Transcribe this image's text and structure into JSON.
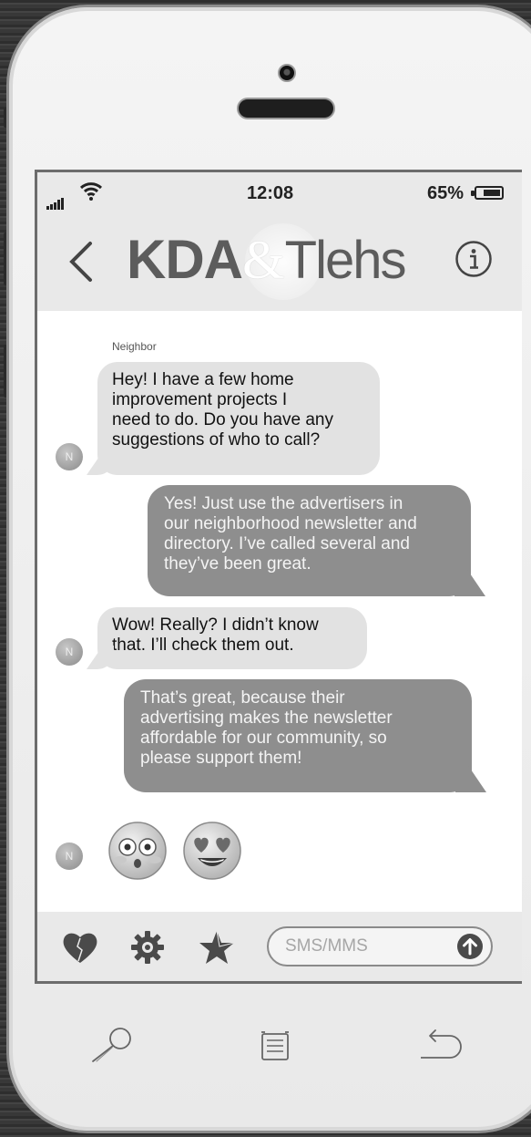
{
  "status_bar": {
    "time": "12:08",
    "battery_percent": "65%"
  },
  "header": {
    "logo_part1": "KDA",
    "logo_amp": "&",
    "logo_part2": "Tlehs"
  },
  "conversation": {
    "sender_label": "Neighbor",
    "avatar_initial": "N",
    "messages": [
      {
        "direction": "incoming",
        "lines": [
          "Hey! I have a few home",
          "improvement projects I",
          "need to do. Do you have any",
          "suggestions of who to call?"
        ]
      },
      {
        "direction": "outgoing",
        "lines": [
          "Yes! Just use the advertisers in",
          "our neighborhood newsletter and",
          "directory. I’ve called several and",
          "they’ve been great."
        ]
      },
      {
        "direction": "incoming",
        "lines": [
          "Wow! Really? I didn’t know",
          "that. I’ll check them out."
        ]
      },
      {
        "direction": "outgoing",
        "lines": [
          "That’s great, because their",
          "advertising makes the newsletter",
          "affordable for our community, so",
          "please support them!"
        ]
      },
      {
        "direction": "incoming",
        "emojis": [
          "flushed-face-icon",
          "heart-eyes-face-icon"
        ]
      }
    ]
  },
  "composer": {
    "placeholder": "SMS/MMS"
  },
  "icons": {
    "toolbar": [
      "heart-icon",
      "gear-icon",
      "star-icon",
      "send-icon"
    ],
    "home_bar": [
      "search-icon",
      "list-icon",
      "return-icon"
    ]
  },
  "colors": {
    "incoming_bubble": "#e2e2e2",
    "outgoing_bubble": "#8e8e8e",
    "header_bg": "#e9e9e9"
  }
}
